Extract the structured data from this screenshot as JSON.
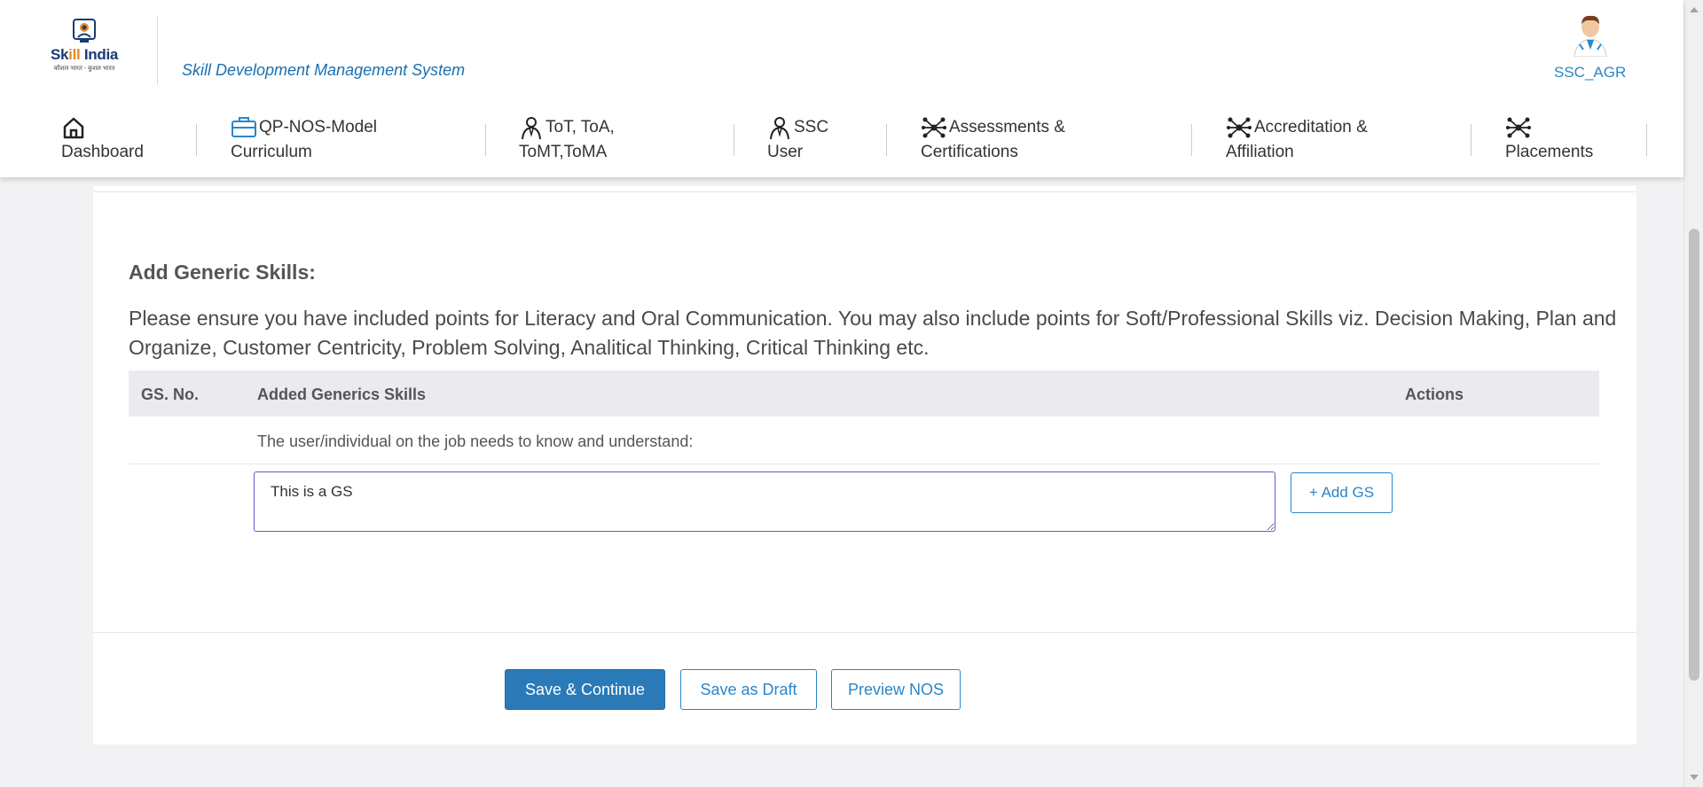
{
  "header": {
    "logo": {
      "name_part1": "Sk",
      "name_part2": "ill",
      "name_part3": " India",
      "tagline": "कौशल भारत - कुशल भारत"
    },
    "app_title": "Skill Development Management System",
    "user": {
      "name": "SSC_AGR",
      "icon": "user-avatar-icon"
    }
  },
  "nav": {
    "items": [
      {
        "label": "Dashboard",
        "icon": "home-icon"
      },
      {
        "label": "QP-NOS-Model Curriculum",
        "line1": "QP-NOS-Model",
        "line2": "Curriculum",
        "icon": "briefcase-icon"
      },
      {
        "label": "ToT, ToA, ToMT,ToMA",
        "line1": "ToT, ToA,",
        "line2": "ToMT,ToMA",
        "icon": "trainer-icon"
      },
      {
        "label": "SSC User",
        "line1": "SSC",
        "line2": "User",
        "icon": "person-icon"
      },
      {
        "label": "Assessments & Certifications",
        "line1": "Assessments &",
        "line2": "Certifications",
        "icon": "network-icon"
      },
      {
        "label": "Accreditation & Affiliation",
        "line1": "Accreditation &",
        "line2": "Affiliation",
        "icon": "network-icon"
      },
      {
        "label": "Placements",
        "icon": "network-icon"
      }
    ]
  },
  "main": {
    "section_title": "Add Generic Skills:",
    "instruction": "Please ensure you have included points for Literacy and Oral Communication. You may also include points for Soft/Professional Skills viz. Decision Making, Plan and Organize, Customer Centricity, Problem Solving, Analitical Thinking, Critical Thinking etc.",
    "table": {
      "headers": {
        "gs_no": "GS. No.",
        "skills": "Added Generics Skills",
        "actions": "Actions"
      },
      "intro_row": "The user/individual on the job needs to know and understand:",
      "input_value": "This is a GS",
      "add_button": "+ Add GS"
    },
    "buttons": {
      "save_continue": "Save & Continue",
      "save_draft": "Save as Draft",
      "preview": "Preview NOS"
    }
  },
  "colors": {
    "primary": "#2a7ab8",
    "link": "#2a86c9",
    "table_header_bg": "#ebebef",
    "page_bg": "#f2f2f4"
  }
}
